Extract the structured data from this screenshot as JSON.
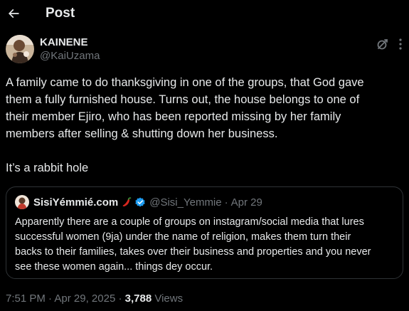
{
  "header": {
    "title": "Post",
    "back_icon": "arrow-left-icon"
  },
  "tweet": {
    "author": {
      "display_name": "KAINENE",
      "handle": "@KaiUzama",
      "avatar_icon": "avatar-photo"
    },
    "actions": {
      "grok_icon": "grok-icon"
    },
    "text_lines": [
      "A family came to do thanksgiving in one of the groups, that God gave",
      "them a fully furnished house. Turns out, the house belongs to one of",
      "their member Ejiro, who has been reported missing by her family",
      "members after selling & shutting down her business."
    ],
    "text_para2": "It’s a rabbit hole",
    "quoted": {
      "display_name": "SisiYémmié.com",
      "emoji": "chili-pepper",
      "verified": true,
      "handle": "@Sisi_Yemmie",
      "separator": "·",
      "date": "Apr 29",
      "text_lines": [
        "Apparently there are a couple of groups on instagram/social media that lures",
        "successful women (9ja) under the name of religion, makes them turn their",
        "backs to their families, takes over their business and properties and you never",
        "see these women again... things dey occur."
      ]
    },
    "meta": {
      "time": "7:51 PM",
      "separator": "·",
      "date": "Apr 29, 2025",
      "views_count": "3,788",
      "views_label": "Views"
    }
  },
  "colors": {
    "background": "#000000",
    "primary_text": "#e7e9ea",
    "secondary_text": "#71767b",
    "border": "#2f3336",
    "verified_blue": "#1d9bf0"
  }
}
